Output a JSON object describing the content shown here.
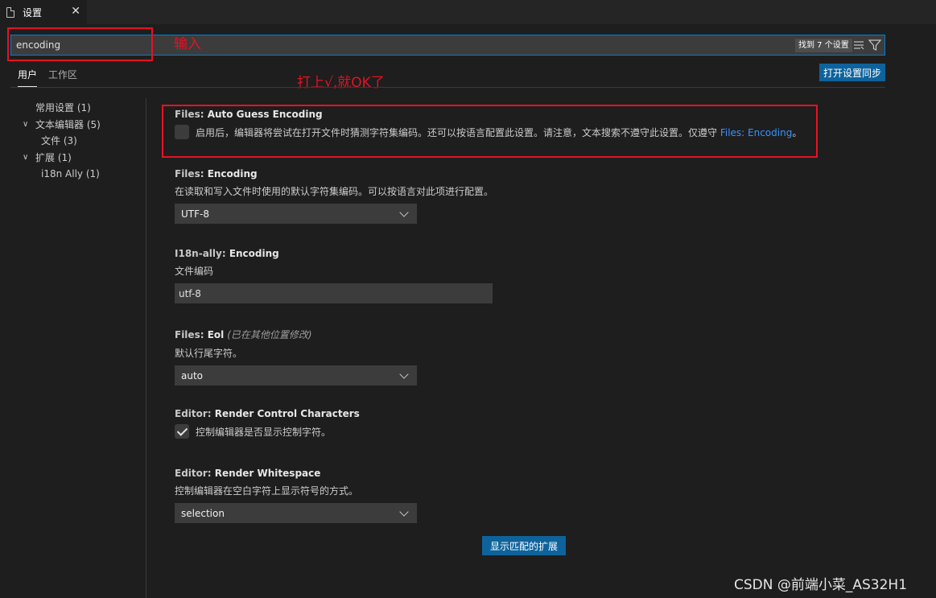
{
  "tab": {
    "title": "设置",
    "close": "✕"
  },
  "search": {
    "value": "encoding",
    "result_count": "找到 7 个设置"
  },
  "annotations": {
    "input_note": "输入",
    "check_note": "打上√,就OK了"
  },
  "scope_tabs": [
    {
      "label": "用户"
    },
    {
      "label": "工作区"
    }
  ],
  "sync_button": "打开设置同步",
  "toc": [
    {
      "label": "常用设置 (1)",
      "chevron": ""
    },
    {
      "label": "文本编辑器 (5)",
      "chevron": "∨"
    },
    {
      "label": "文件 (3)",
      "chevron": ""
    },
    {
      "label": "扩展 (1)",
      "chevron": "∨"
    },
    {
      "label": "i18n Ally (1)",
      "chevron": ""
    }
  ],
  "settings": {
    "auto_guess": {
      "category": "Files: ",
      "name": "Auto Guess Encoding",
      "desc": "启用后，编辑器将尝试在打开文件时猜测字符集编码。还可以按语言配置此设置。请注意，文本搜索不遵守此设置。仅遵守 ",
      "link": "Files: Encoding",
      "suffix": "。",
      "checked": false
    },
    "encoding": {
      "category": "Files: ",
      "name": "Encoding",
      "desc": "在读取和写入文件时使用的默认字符集编码。可以按语言对此项进行配置。",
      "value": "UTF-8"
    },
    "i18n_encoding": {
      "category": "I18n-ally: ",
      "name": "Encoding",
      "desc": "文件编码",
      "value": "utf-8"
    },
    "eol": {
      "category": "Files: ",
      "name": "Eol",
      "modified": "(已在其他位置修改)",
      "desc": "默认行尾字符。",
      "value": "auto"
    },
    "render_control": {
      "category": "Editor: ",
      "name": "Render Control Characters",
      "desc": "控制编辑器是否显示控制字符。",
      "checked": true
    },
    "render_whitespace": {
      "category": "Editor: ",
      "name": "Render Whitespace",
      "desc": "控制编辑器在空白字符上显示符号的方式。",
      "value": "selection"
    }
  },
  "show_extensions_button": "显示匹配的扩展",
  "watermark": "CSDN @前端小菜_AS32H1",
  "colors": {
    "accent": "#0e639c",
    "annotation": "#e81123",
    "link": "#3794ff",
    "focus": "#007fd4"
  }
}
